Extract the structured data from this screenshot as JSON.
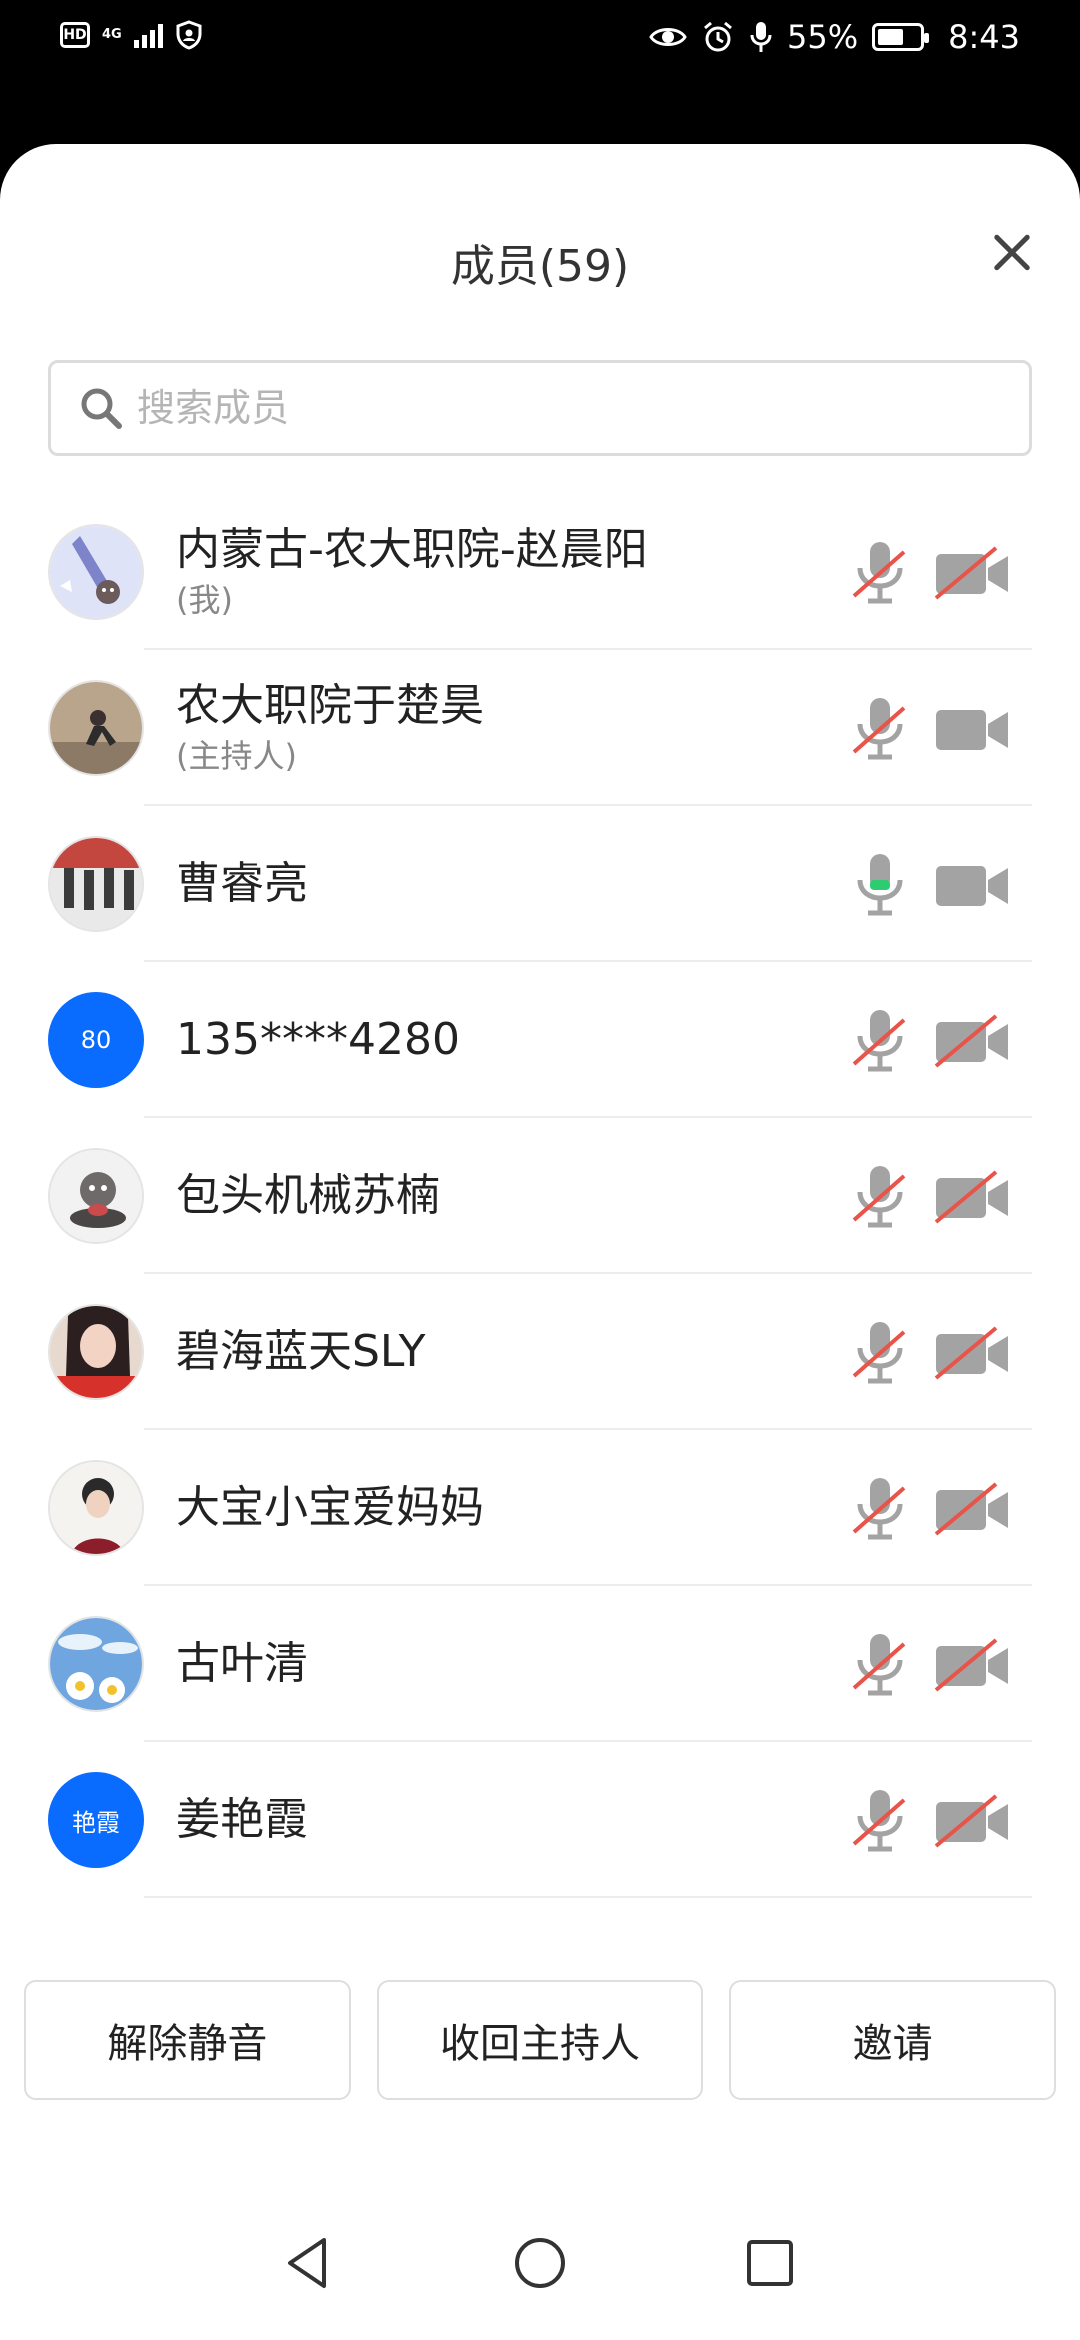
{
  "status_bar": {
    "hd": "HD",
    "network": "4G",
    "battery": "55%",
    "time": "8:43"
  },
  "sheet": {
    "title": "成员(59)"
  },
  "search": {
    "placeholder": "搜索成员"
  },
  "members": [
    {
      "name": "内蒙古-农大职院-赵晨阳",
      "role": "(我)",
      "avatar": "photo",
      "mic_muted": true,
      "camera_off": true
    },
    {
      "name": "农大职院于楚昊",
      "role": "(主持人)",
      "avatar": "photo",
      "mic_muted": true,
      "camera_off": false
    },
    {
      "name": "曹睿亮",
      "role": "",
      "avatar": "photo",
      "mic_muted": false,
      "camera_off": false
    },
    {
      "name": "135****4280",
      "role": "",
      "avatar_text": "80",
      "mic_muted": true,
      "camera_off": true
    },
    {
      "name": "包头机械苏楠",
      "role": "",
      "avatar": "photo",
      "mic_muted": true,
      "camera_off": true
    },
    {
      "name": "碧海蓝天SLY",
      "role": "",
      "avatar": "photo",
      "mic_muted": true,
      "camera_off": true
    },
    {
      "name": "大宝小宝爱妈妈",
      "role": "",
      "avatar": "photo",
      "mic_muted": true,
      "camera_off": true
    },
    {
      "name": "古叶清",
      "role": "",
      "avatar": "photo",
      "mic_muted": true,
      "camera_off": true
    },
    {
      "name": "姜艳霞",
      "role": "",
      "avatar_text": "艳霞",
      "mic_muted": true,
      "camera_off": true
    }
  ],
  "actions": {
    "unmute": "解除静音",
    "reclaim_host": "收回主持人",
    "invite": "邀请"
  },
  "colors": {
    "accent": "#0a6cff",
    "muted_slash": "#e8534a",
    "icon_gray": "#9a9a9a",
    "mic_active": "#2ecc71"
  }
}
